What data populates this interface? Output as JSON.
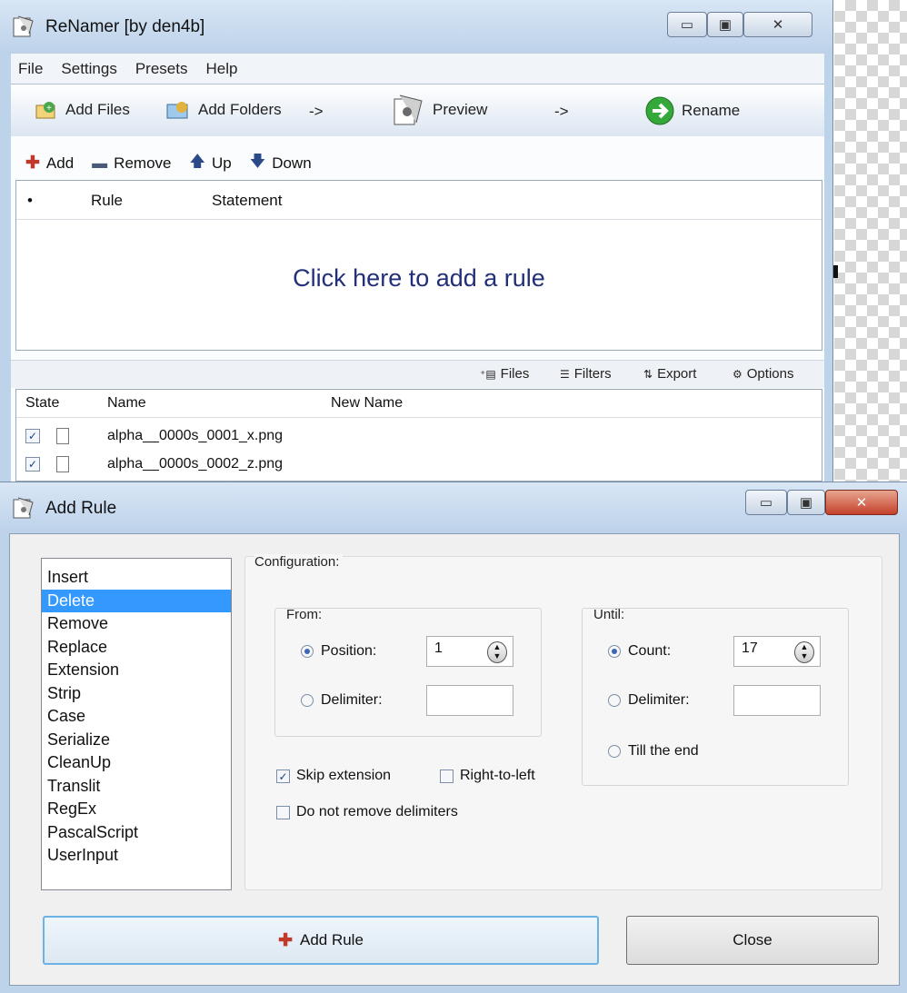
{
  "main": {
    "title": "ReNamer  [by den4b]",
    "menu": [
      "File",
      "Settings",
      "Presets",
      "Help"
    ],
    "toolbar": {
      "add_files": "Add Files",
      "add_folders": "Add Folders",
      "arrow1": "->",
      "preview": "Preview",
      "arrow2": "->",
      "rename": "Rename"
    },
    "rule_toolbar": {
      "add": "Add",
      "remove": "Remove",
      "up": "Up",
      "down": "Down"
    },
    "rules_table": {
      "columns": [
        "•",
        "Rule",
        "Statement"
      ],
      "placeholder": "Click here to add a rule"
    },
    "files_bar": {
      "files": "Files",
      "filters": "Filters",
      "export": "Export",
      "options": "Options"
    },
    "files_table": {
      "columns": [
        "State",
        "Name",
        "New Name"
      ],
      "rows": [
        {
          "checked": "✓",
          "name": "alpha__0000s_0001_x.png",
          "new_name": ""
        },
        {
          "checked": "✓",
          "name": "alpha__0000s_0002_z.png",
          "new_name": ""
        }
      ]
    }
  },
  "dialog": {
    "title": "Add Rule",
    "rules": [
      "Insert",
      "Delete",
      "Remove",
      "Replace",
      "Extension",
      "Strip",
      "Case",
      "Serialize",
      "CleanUp",
      "Translit",
      "RegEx",
      "PascalScript",
      "UserInput"
    ],
    "selected_rule": "Delete",
    "config_label": "Configuration:",
    "from": {
      "label": "From:",
      "position_label": "Position:",
      "position_value": "1",
      "delimiter_label": "Delimiter:",
      "delimiter_value": "",
      "selected": "Position"
    },
    "until": {
      "label": "Until:",
      "count_label": "Count:",
      "count_value": "17",
      "delimiter_label": "Delimiter:",
      "delimiter_value": "",
      "till_end_label": "Till the end",
      "selected": "Count"
    },
    "skip_extension": {
      "label": "Skip extension",
      "checked": true
    },
    "right_to_left": {
      "label": "Right-to-left",
      "checked": false
    },
    "do_not_remove_delimiters": {
      "label": "Do not remove delimiters",
      "checked": false
    },
    "add_rule_button": "Add Rule",
    "close_button": "Close"
  },
  "colors": {
    "selection": "#3399ff",
    "link_text": "#222f7a",
    "window_frame": "#bcd3ea"
  }
}
